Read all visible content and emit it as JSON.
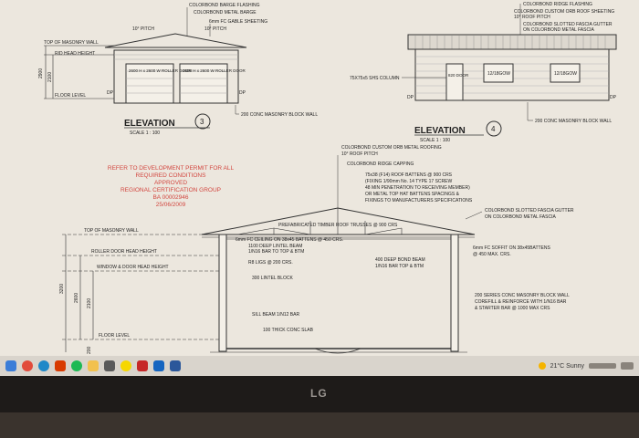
{
  "drawing": {
    "elev3": {
      "title": "ELEVATION",
      "number": "3",
      "scale": "SCALE 1 : 100",
      "notes": [
        "COLORBOND BARGE FLASHING",
        "COLORBOND METAL BARGE",
        "6mm FC GABLE SHEETING",
        "10° PITCH",
        "10° PITCH"
      ],
      "top_wall": "TOP OF MASONRY WALL",
      "rid_head": "RID HEAD HEIGHT",
      "floor": "FLOOR LEVEL",
      "dim": "2900",
      "dim2": "2100",
      "dp_left": "DP",
      "dp_right": "DP",
      "door1": "2600 H x 2600 W ROLLER DOOR",
      "door2": "2600 H x 2600 W ROLLER DOOR",
      "wall_note": "200 CONC MASONRY BLOCK WALL"
    },
    "elev4": {
      "title": "ELEVATION",
      "number": "4",
      "scale": "SCALE 1 : 100",
      "notes": [
        "COLORBOND RIDGE FLASHING",
        "COLORBOND CUSTOM ORB ROOF SHEETING",
        "10° ROOF PITCH",
        "COLORBOND SLOTTED FASCIA GUTTER",
        "ON COLORBOND METAL FASCIA"
      ],
      "shs": "75X75x5 SHS COLUMN",
      "door": "820 DOOR",
      "win1": "12/18GOW",
      "win2": "12/18GOW",
      "dp_left": "DP",
      "dp_right": "DP",
      "wall_note": "200 CONC MASONRY BLOCK WALL"
    },
    "approval": [
      "REFER TO DEVELOPMENT PERMIT FOR ALL",
      "REQUIRED CONDITIONS",
      "APPROVED",
      "REGIONAL CERTIFICATION GROUP",
      "BA 00002946",
      "25/06/2009"
    ],
    "section": {
      "top_notes": [
        "COLORBOND CUSTOM ORB METAL ROOFING",
        "10° ROOF PITCH",
        "COLORBOND RIDGE CAPPING",
        "75x38 (F14) ROOF BATTENS @ 900 CRS",
        "(FIXING 1/90mm No. 14 TYPE 17 SCREW",
        "48 MIN PENETRATION TO RECEIVING MEMBER)",
        "OR METAL TOP HAT BATTENS SPACINGS &",
        "FIXINGS TO MANUFACTURERS SPECIFICATIONS"
      ],
      "right_notes": [
        "COLORBOND SLOTTED FASCIA GUTTER",
        "ON COLORBOND METAL FASCIA"
      ],
      "truss": "PREFABRICATED TIMBER ROOF TRUSSES @ 900 CRS",
      "ceiling": "6mm FC CEILING ON 38x45 BATTENS @ 450 CRS.",
      "lintel": "1100 DEEP LINTEL BEAM",
      "lintel2": "1/N16 BAR TO TOP & BTM",
      "ligs": "R8 LIGS @ 200 CRS.",
      "lintel_block": "300 LINTEL BLOCK",
      "bond": "400 DEEP BOND BEAM",
      "bond2": "1/N16 BAR TOP & BTM",
      "soffit": "6mm FC SOFFIT ON 38x45BATTENS",
      "soffit2": "@ 450 MAX. CRS.",
      "sill": "SILL BEAM 1/N12 BAR",
      "slab": "100 THICK CONC SLAB",
      "wall_notes": [
        "200 SERIES CONC MASONRY BLOCK WALL",
        "COREFILL & REINFORCE WITH 1/N16 BAR",
        "& STARTER BAR @ 1000 MAX CRS"
      ],
      "levels": {
        "top": "TOP OF MASONRY WALL",
        "roller": "ROLLER DOOR HEAD HEIGHT",
        "window": "WINDOW & DOOR HEAD HEIGHT",
        "floor": "FLOOR LEVEL"
      },
      "dims": [
        "3200",
        "2600",
        "2100",
        "200"
      ]
    }
  },
  "taskbar": {
    "weather": "21°C  Sunny",
    "icons": [
      "copilot-icon",
      "chrome-icon",
      "edge-icon",
      "office-icon",
      "spotify-icon",
      "file-explorer-icon",
      "store-icon",
      "sketch-icon",
      "pdf-icon",
      "mail-icon",
      "word-icon"
    ]
  },
  "monitor": {
    "brand": "LG"
  },
  "colors": {
    "paper": "#ece7de",
    "stamp": "#d2463f",
    "ink": "#222222"
  }
}
